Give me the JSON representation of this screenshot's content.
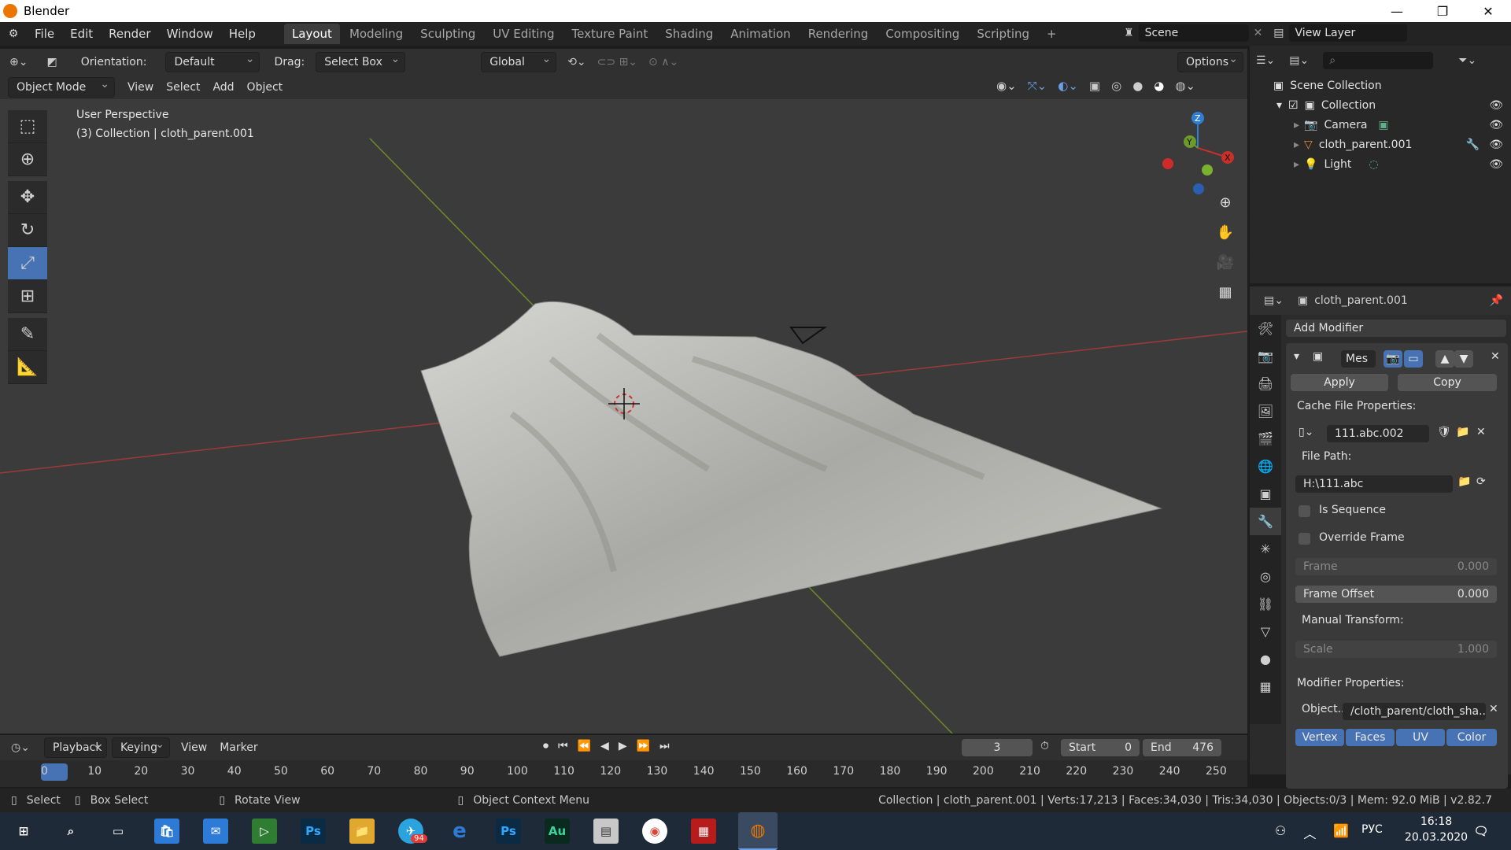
{
  "window": {
    "title": "Blender",
    "controls": [
      "—",
      "❐",
      "✕"
    ]
  },
  "menubar": {
    "menus": [
      "File",
      "Edit",
      "Render",
      "Window",
      "Help"
    ],
    "workspaces": [
      "Layout",
      "Modeling",
      "Sculpting",
      "UV Editing",
      "Texture Paint",
      "Shading",
      "Animation",
      "Rendering",
      "Compositing",
      "Scripting"
    ],
    "active_workspace": "Layout",
    "add_workspace": "+",
    "scene": "Scene",
    "view_layer": "View Layer"
  },
  "viewport_header": {
    "orientation_label": "Orientation:",
    "orientation_value": "Default",
    "drag_label": "Drag:",
    "drag_value": "Select Box",
    "transform_orientation": "Global",
    "options": "Options",
    "mode": "Object Mode",
    "menus": [
      "View",
      "Select",
      "Add",
      "Object"
    ]
  },
  "viewport": {
    "perspective": "User Perspective",
    "collection_info": "(3) Collection | cloth_parent.001",
    "gizmo_axes": {
      "z": "Z",
      "y": "Y",
      "x": "X"
    }
  },
  "outliner": {
    "root": "Scene Collection",
    "collection": "Collection",
    "items": [
      {
        "name": "Camera",
        "icon": "camera-icon"
      },
      {
        "name": "cloth_parent.001",
        "icon": "mesh-icon"
      },
      {
        "name": "Light",
        "icon": "light-icon"
      }
    ]
  },
  "properties": {
    "object_name": "cloth_parent.001",
    "add_modifier": "Add Modifier",
    "modifier_name": "Mes",
    "apply": "Apply",
    "copy": "Copy",
    "cache_file_properties": "Cache File Properties:",
    "cache_file": "111.abc.002",
    "file_path_label": "File Path:",
    "file_path": "H:\\111.abc",
    "is_sequence": "Is Sequence",
    "override_frame": "Override Frame",
    "frame_label": "Frame",
    "frame_value": "0.000",
    "frame_offset_label": "Frame Offset",
    "frame_offset_value": "0.000",
    "manual_transform": "Manual Transform:",
    "scale_label": "Scale",
    "scale_value": "1.000",
    "modifier_properties": "Modifier Properties:",
    "object_path_label": "Object..",
    "object_path": "/cloth_parent/cloth_sha..",
    "data_toggles": [
      "Vertex",
      "Faces",
      "UV",
      "Color"
    ]
  },
  "timeline": {
    "menus": [
      "Playback",
      "Keying",
      "View",
      "Marker"
    ],
    "current_frame": "3",
    "start_label": "Start",
    "start": "0",
    "end_label": "End",
    "end": "476",
    "ruler": [
      "0",
      "10",
      "20",
      "30",
      "40",
      "50",
      "60",
      "70",
      "80",
      "90",
      "100",
      "110",
      "120",
      "130",
      "140",
      "150",
      "160",
      "170",
      "180",
      "190",
      "200",
      "210",
      "220",
      "230",
      "240",
      "250"
    ]
  },
  "statusbar": {
    "select": "Select",
    "box_select": "Box Select",
    "rotate_view": "Rotate View",
    "context_menu": "Object Context Menu",
    "stats": "Collection | cloth_parent.001 | Verts:17,213 | Faces:34,030 | Tris:34,030 | Objects:0/3 | Mem: 92.0 MiB | v2.82.7"
  },
  "taskbar": {
    "lang": "РУС",
    "time": "16:18",
    "date": "20.03.2020",
    "telegram_badge": "94"
  },
  "colors": {
    "accent": "#4772b3",
    "x_axis": "#c9302c",
    "y_axis": "#6e9a2a",
    "z_axis": "#2f7fd6"
  }
}
